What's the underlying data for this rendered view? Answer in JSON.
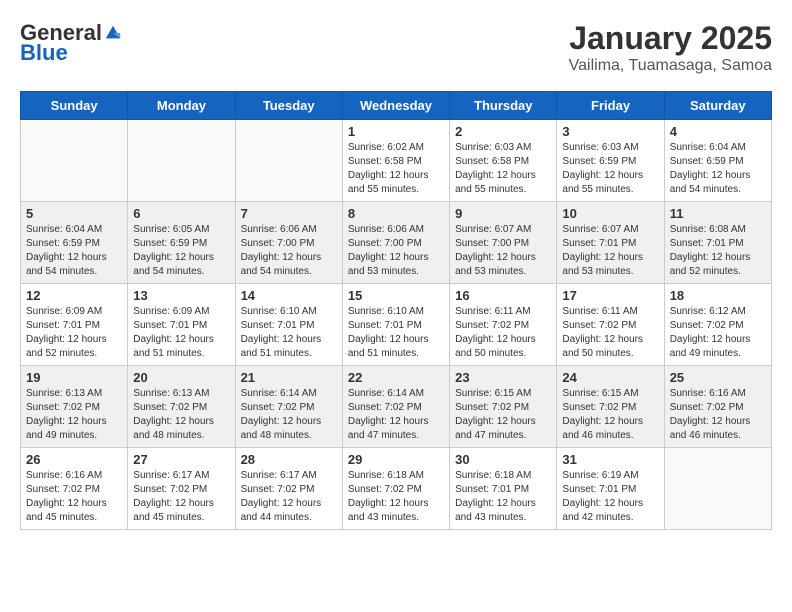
{
  "header": {
    "logo_general": "General",
    "logo_blue": "Blue",
    "month_year": "January 2025",
    "location": "Vailima, Tuamasaga, Samoa"
  },
  "days_of_week": [
    "Sunday",
    "Monday",
    "Tuesday",
    "Wednesday",
    "Thursday",
    "Friday",
    "Saturday"
  ],
  "weeks": [
    [
      {
        "day": "",
        "info": ""
      },
      {
        "day": "",
        "info": ""
      },
      {
        "day": "",
        "info": ""
      },
      {
        "day": "1",
        "info": "Sunrise: 6:02 AM\nSunset: 6:58 PM\nDaylight: 12 hours\nand 55 minutes."
      },
      {
        "day": "2",
        "info": "Sunrise: 6:03 AM\nSunset: 6:58 PM\nDaylight: 12 hours\nand 55 minutes."
      },
      {
        "day": "3",
        "info": "Sunrise: 6:03 AM\nSunset: 6:59 PM\nDaylight: 12 hours\nand 55 minutes."
      },
      {
        "day": "4",
        "info": "Sunrise: 6:04 AM\nSunset: 6:59 PM\nDaylight: 12 hours\nand 54 minutes."
      }
    ],
    [
      {
        "day": "5",
        "info": "Sunrise: 6:04 AM\nSunset: 6:59 PM\nDaylight: 12 hours\nand 54 minutes."
      },
      {
        "day": "6",
        "info": "Sunrise: 6:05 AM\nSunset: 6:59 PM\nDaylight: 12 hours\nand 54 minutes."
      },
      {
        "day": "7",
        "info": "Sunrise: 6:06 AM\nSunset: 7:00 PM\nDaylight: 12 hours\nand 54 minutes."
      },
      {
        "day": "8",
        "info": "Sunrise: 6:06 AM\nSunset: 7:00 PM\nDaylight: 12 hours\nand 53 minutes."
      },
      {
        "day": "9",
        "info": "Sunrise: 6:07 AM\nSunset: 7:00 PM\nDaylight: 12 hours\nand 53 minutes."
      },
      {
        "day": "10",
        "info": "Sunrise: 6:07 AM\nSunset: 7:01 PM\nDaylight: 12 hours\nand 53 minutes."
      },
      {
        "day": "11",
        "info": "Sunrise: 6:08 AM\nSunset: 7:01 PM\nDaylight: 12 hours\nand 52 minutes."
      }
    ],
    [
      {
        "day": "12",
        "info": "Sunrise: 6:09 AM\nSunset: 7:01 PM\nDaylight: 12 hours\nand 52 minutes."
      },
      {
        "day": "13",
        "info": "Sunrise: 6:09 AM\nSunset: 7:01 PM\nDaylight: 12 hours\nand 51 minutes."
      },
      {
        "day": "14",
        "info": "Sunrise: 6:10 AM\nSunset: 7:01 PM\nDaylight: 12 hours\nand 51 minutes."
      },
      {
        "day": "15",
        "info": "Sunrise: 6:10 AM\nSunset: 7:01 PM\nDaylight: 12 hours\nand 51 minutes."
      },
      {
        "day": "16",
        "info": "Sunrise: 6:11 AM\nSunset: 7:02 PM\nDaylight: 12 hours\nand 50 minutes."
      },
      {
        "day": "17",
        "info": "Sunrise: 6:11 AM\nSunset: 7:02 PM\nDaylight: 12 hours\nand 50 minutes."
      },
      {
        "day": "18",
        "info": "Sunrise: 6:12 AM\nSunset: 7:02 PM\nDaylight: 12 hours\nand 49 minutes."
      }
    ],
    [
      {
        "day": "19",
        "info": "Sunrise: 6:13 AM\nSunset: 7:02 PM\nDaylight: 12 hours\nand 49 minutes."
      },
      {
        "day": "20",
        "info": "Sunrise: 6:13 AM\nSunset: 7:02 PM\nDaylight: 12 hours\nand 48 minutes."
      },
      {
        "day": "21",
        "info": "Sunrise: 6:14 AM\nSunset: 7:02 PM\nDaylight: 12 hours\nand 48 minutes."
      },
      {
        "day": "22",
        "info": "Sunrise: 6:14 AM\nSunset: 7:02 PM\nDaylight: 12 hours\nand 47 minutes."
      },
      {
        "day": "23",
        "info": "Sunrise: 6:15 AM\nSunset: 7:02 PM\nDaylight: 12 hours\nand 47 minutes."
      },
      {
        "day": "24",
        "info": "Sunrise: 6:15 AM\nSunset: 7:02 PM\nDaylight: 12 hours\nand 46 minutes."
      },
      {
        "day": "25",
        "info": "Sunrise: 6:16 AM\nSunset: 7:02 PM\nDaylight: 12 hours\nand 46 minutes."
      }
    ],
    [
      {
        "day": "26",
        "info": "Sunrise: 6:16 AM\nSunset: 7:02 PM\nDaylight: 12 hours\nand 45 minutes."
      },
      {
        "day": "27",
        "info": "Sunrise: 6:17 AM\nSunset: 7:02 PM\nDaylight: 12 hours\nand 45 minutes."
      },
      {
        "day": "28",
        "info": "Sunrise: 6:17 AM\nSunset: 7:02 PM\nDaylight: 12 hours\nand 44 minutes."
      },
      {
        "day": "29",
        "info": "Sunrise: 6:18 AM\nSunset: 7:02 PM\nDaylight: 12 hours\nand 43 minutes."
      },
      {
        "day": "30",
        "info": "Sunrise: 6:18 AM\nSunset: 7:01 PM\nDaylight: 12 hours\nand 43 minutes."
      },
      {
        "day": "31",
        "info": "Sunrise: 6:19 AM\nSunset: 7:01 PM\nDaylight: 12 hours\nand 42 minutes."
      },
      {
        "day": "",
        "info": ""
      }
    ]
  ]
}
